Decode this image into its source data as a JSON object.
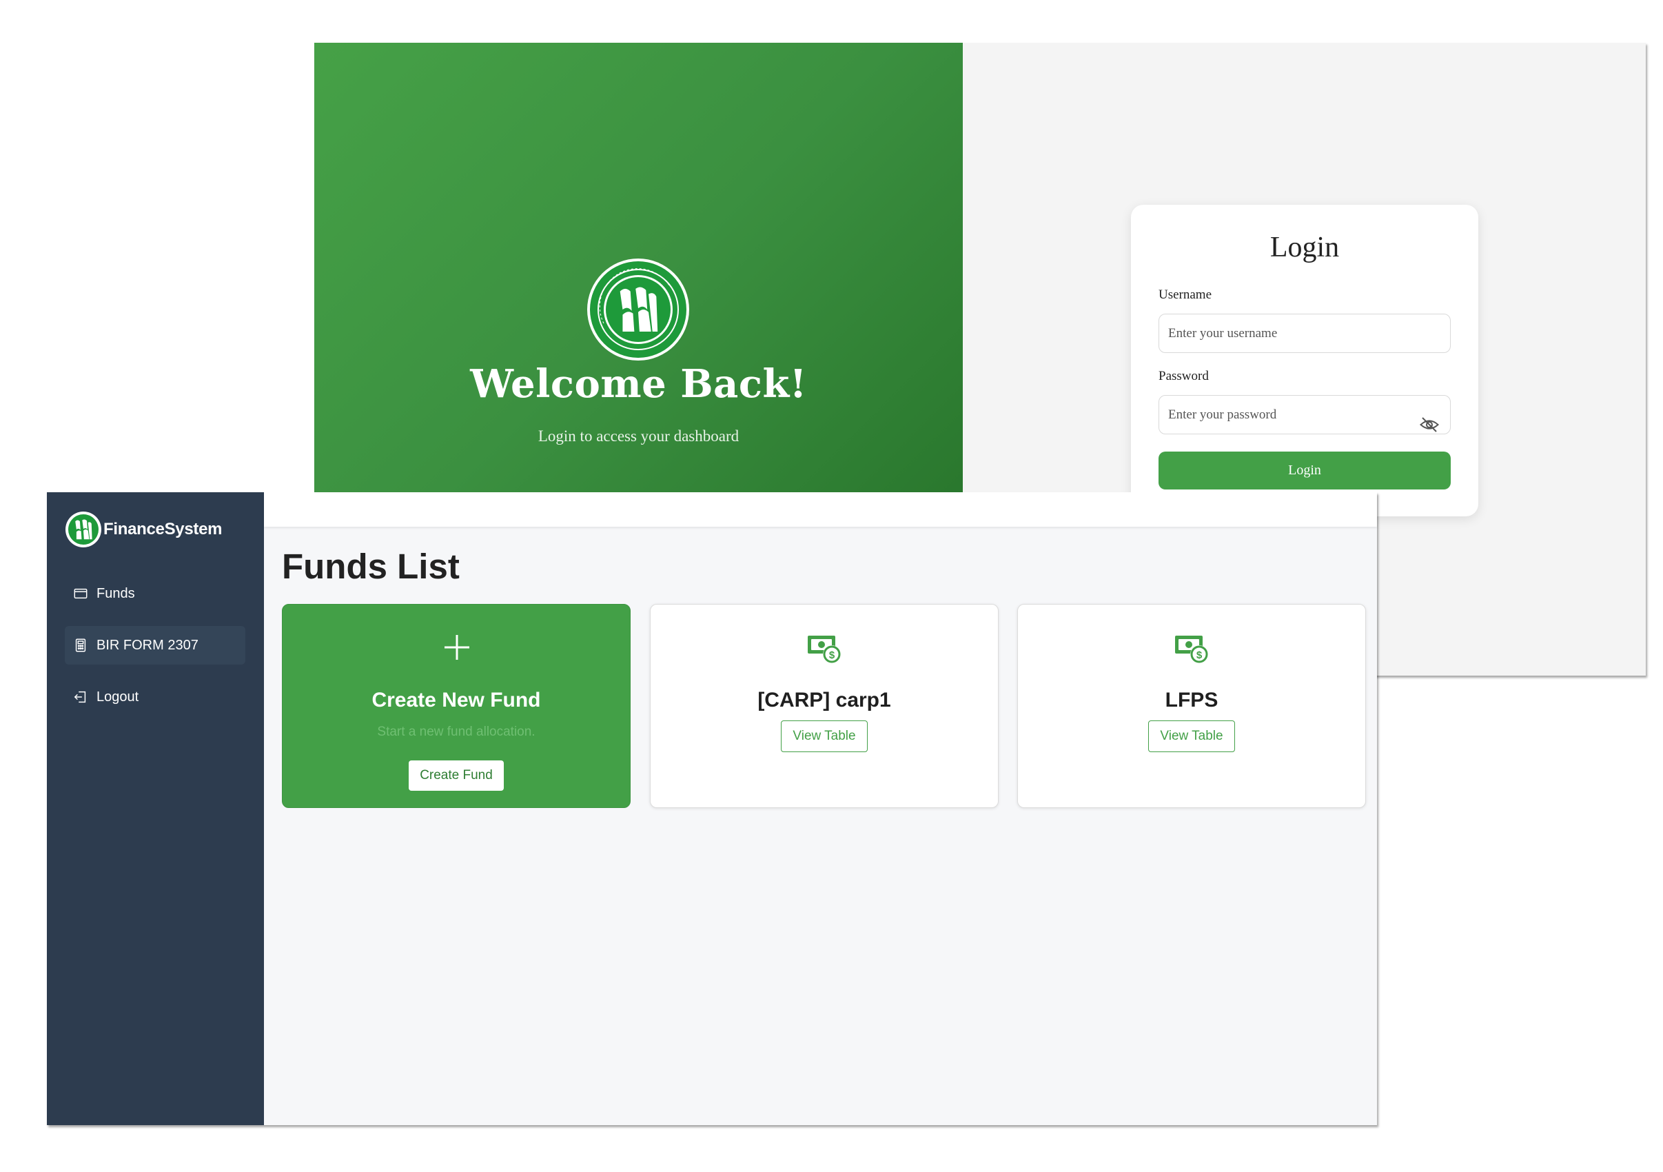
{
  "login_page": {
    "welcome_title": "Welcome Back!",
    "welcome_subtitle": "Login to access your dashboard",
    "logo_icon": "nia-seal-icon",
    "form": {
      "title": "Login",
      "username_label": "Username",
      "username_placeholder": "Enter your username",
      "password_label": "Password",
      "password_placeholder": "Enter your password",
      "toggle_icon": "eye-off-icon",
      "submit_label": "Login"
    }
  },
  "dashboard": {
    "brand": {
      "name": "FinanceSystem",
      "logo_icon": "nia-logo-icon"
    },
    "sidebar": {
      "items": [
        {
          "label": "Funds",
          "icon": "wallet-icon",
          "active": false
        },
        {
          "label": "BIR FORM 2307",
          "icon": "calculator-icon",
          "active": true
        },
        {
          "label": "Logout",
          "icon": "logout-icon",
          "active": false
        }
      ]
    },
    "page_title": "Funds List",
    "create_card": {
      "icon": "plus-icon",
      "title": "Create New Fund",
      "subtitle": "Start a new fund allocation.",
      "button_label": "Create Fund"
    },
    "funds": [
      {
        "name": "[CARP] carp1",
        "icon": "money-icon",
        "button_label": "View Table"
      },
      {
        "name": "LFPS",
        "icon": "money-icon",
        "button_label": "View Table"
      }
    ]
  },
  "colors": {
    "primary_green": "#43a047",
    "dark_green": "#246f27",
    "sidebar_bg": "#2d3c4f",
    "sidebar_active": "#344558",
    "page_bg": "#f6f7f9",
    "login_bg": "#f4f4f4"
  }
}
